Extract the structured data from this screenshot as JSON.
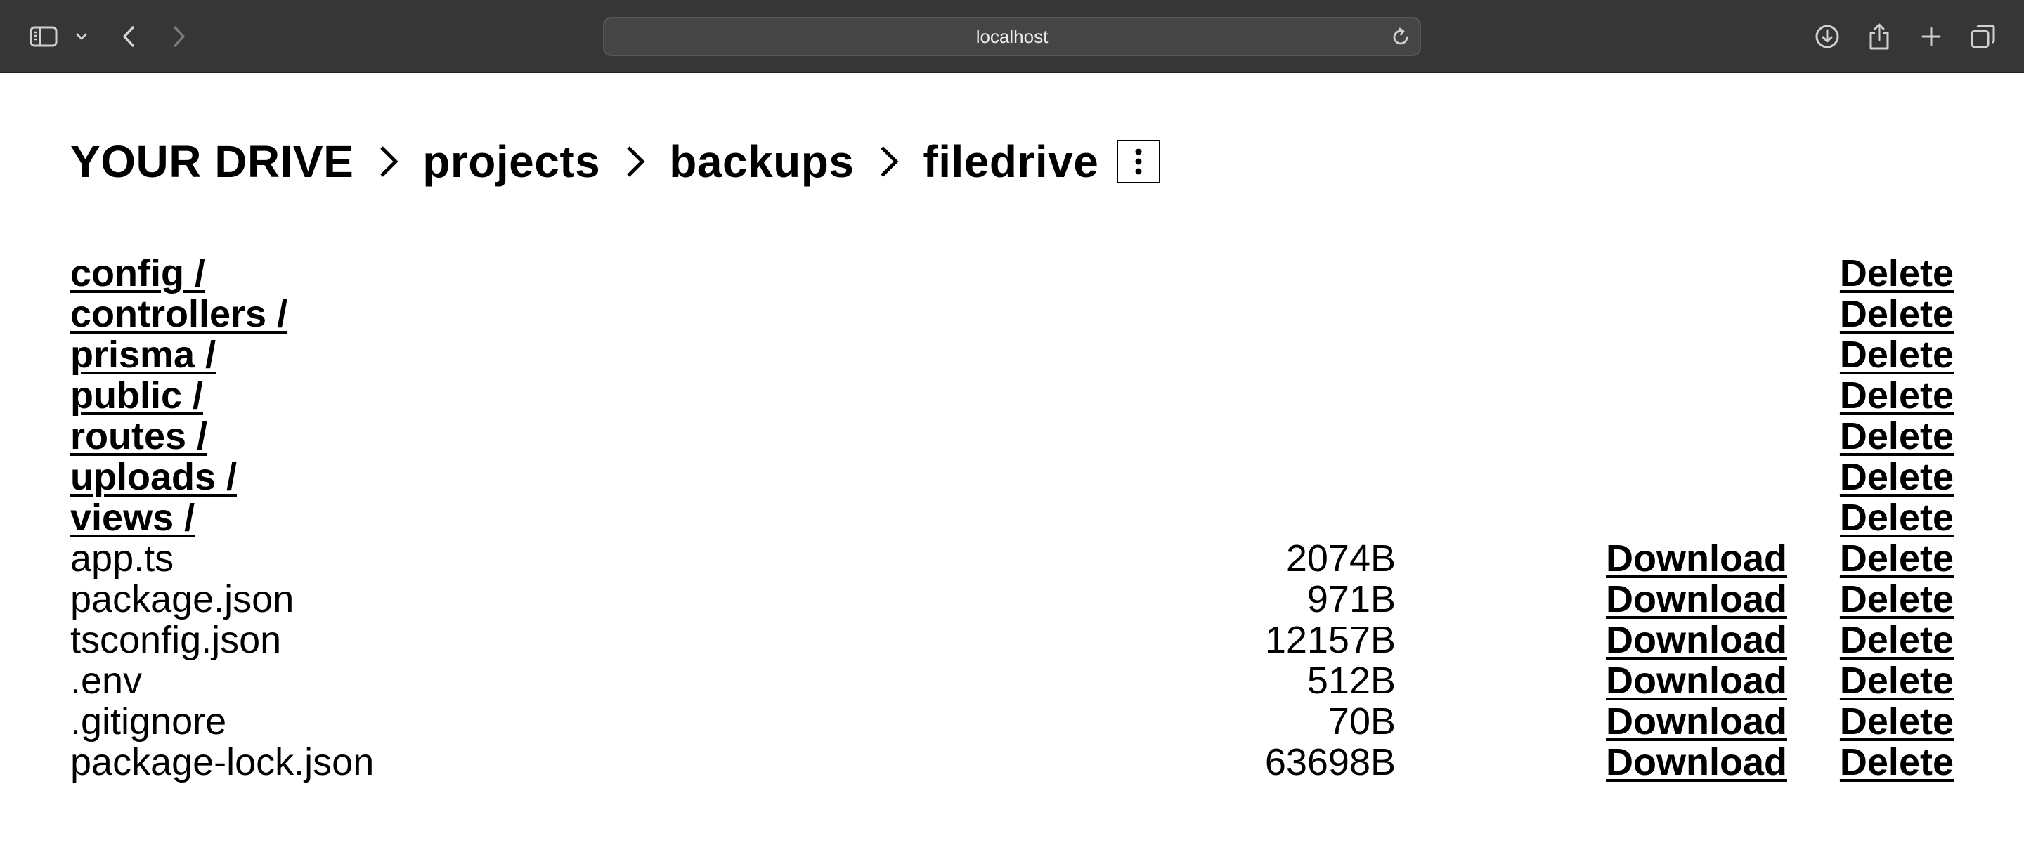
{
  "browser": {
    "url": "localhost"
  },
  "breadcrumb": {
    "items": [
      "YOUR DRIVE",
      "projects",
      "backups",
      "filedrive"
    ]
  },
  "labels": {
    "download": "Download",
    "delete": "Delete"
  },
  "folders": [
    {
      "name": "config /"
    },
    {
      "name": "controllers /"
    },
    {
      "name": "prisma /"
    },
    {
      "name": "public /"
    },
    {
      "name": "routes /"
    },
    {
      "name": "uploads /"
    },
    {
      "name": "views /"
    }
  ],
  "files": [
    {
      "name": "app.ts",
      "size": "2074B"
    },
    {
      "name": "package.json",
      "size": "971B"
    },
    {
      "name": "tsconfig.json",
      "size": "12157B"
    },
    {
      "name": ".env",
      "size": "512B"
    },
    {
      "name": ".gitignore",
      "size": "70B"
    },
    {
      "name": "package-lock.json",
      "size": "63698B"
    }
  ]
}
